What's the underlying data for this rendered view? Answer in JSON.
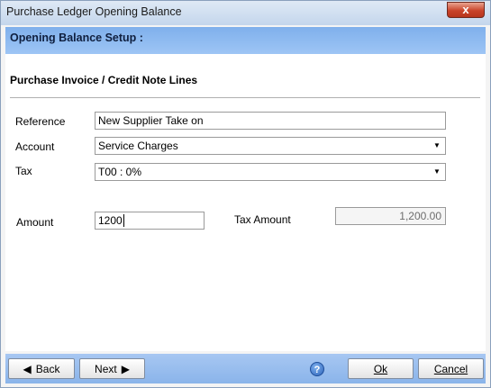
{
  "window": {
    "title": "Purchase Ledger Opening Balance",
    "close_symbol": "x"
  },
  "header": {
    "title": "Opening Balance Setup :"
  },
  "section": {
    "title": "Purchase Invoice / Credit Note Lines"
  },
  "form": {
    "reference": {
      "label": "Reference",
      "value": "New Supplier Take on"
    },
    "account": {
      "label": "Account",
      "value": "Service Charges"
    },
    "tax": {
      "label": "Tax",
      "value": "T00 : 0%"
    },
    "amount": {
      "label": "Amount",
      "value": "1200"
    },
    "tax_amount": {
      "label": "Tax Amount",
      "value": "1,200.00"
    }
  },
  "footer": {
    "back_label": "Back",
    "back_icon": "◀",
    "next_label": "Next",
    "next_icon": "▶",
    "help_symbol": "?",
    "ok_label": "Ok",
    "cancel_label": "Cancel"
  }
}
